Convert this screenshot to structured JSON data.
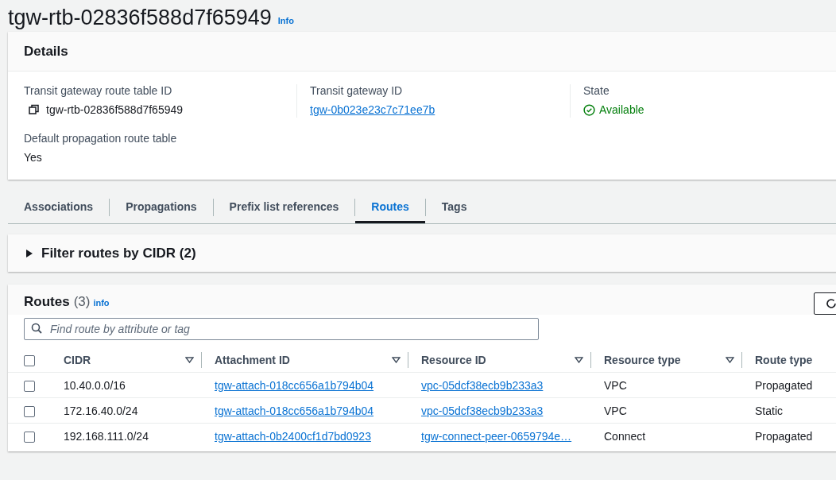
{
  "page": {
    "title": "tgw-rtb-02836f588d7f65949",
    "info": "Info"
  },
  "details": {
    "title": "Details",
    "fields": [
      {
        "kind": "copy",
        "label": "Transit gateway route table ID",
        "value": "tgw-rtb-02836f588d7f65949"
      },
      {
        "kind": "link",
        "label": "Transit gateway ID",
        "value": "tgw-0b023e23c7c71ee7b"
      },
      {
        "kind": "status",
        "label": "State",
        "value": "Available"
      },
      {
        "kind": "text",
        "label": "Default propagation route table",
        "value": "Yes"
      }
    ]
  },
  "tabs": [
    {
      "label": "Associations",
      "selected": false
    },
    {
      "label": "Propagations",
      "selected": false
    },
    {
      "label": "Prefix list references",
      "selected": false
    },
    {
      "label": "Routes",
      "selected": true
    },
    {
      "label": "Tags",
      "selected": false
    }
  ],
  "filter": {
    "title": "Filter routes by CIDR (2)",
    "expanded": false
  },
  "routes": {
    "all_checked": false,
    "title": "Routes",
    "count": "(3)",
    "info": "info",
    "search": {
      "placeholder": "Find route by attribute or tag"
    },
    "columns": [
      {
        "label": "CIDR",
        "sortable": true
      },
      {
        "label": "Attachment ID",
        "sortable": true
      },
      {
        "label": "Resource ID",
        "sortable": true
      },
      {
        "label": "Resource type",
        "sortable": true
      },
      {
        "label": "Route type",
        "sortable": false
      }
    ],
    "rows": [
      {
        "checked": false,
        "cells": [
          "10.40.0.0/16",
          "tgw-attach-018cc656a1b794b04",
          "vpc-05dcf38ecb9b233a3",
          "VPC",
          "Propagated"
        ]
      },
      {
        "checked": false,
        "cells": [
          "172.16.40.0/24",
          "tgw-attach-018cc656a1b794b04",
          "vpc-05dcf38ecb9b233a3",
          "VPC",
          "Static"
        ]
      },
      {
        "checked": false,
        "cells": [
          "192.168.111.0/24",
          "tgw-attach-0b2400cf1d7bd0923",
          "tgw-connect-peer-0659794e…",
          "Connect",
          "Propagated"
        ]
      }
    ]
  }
}
